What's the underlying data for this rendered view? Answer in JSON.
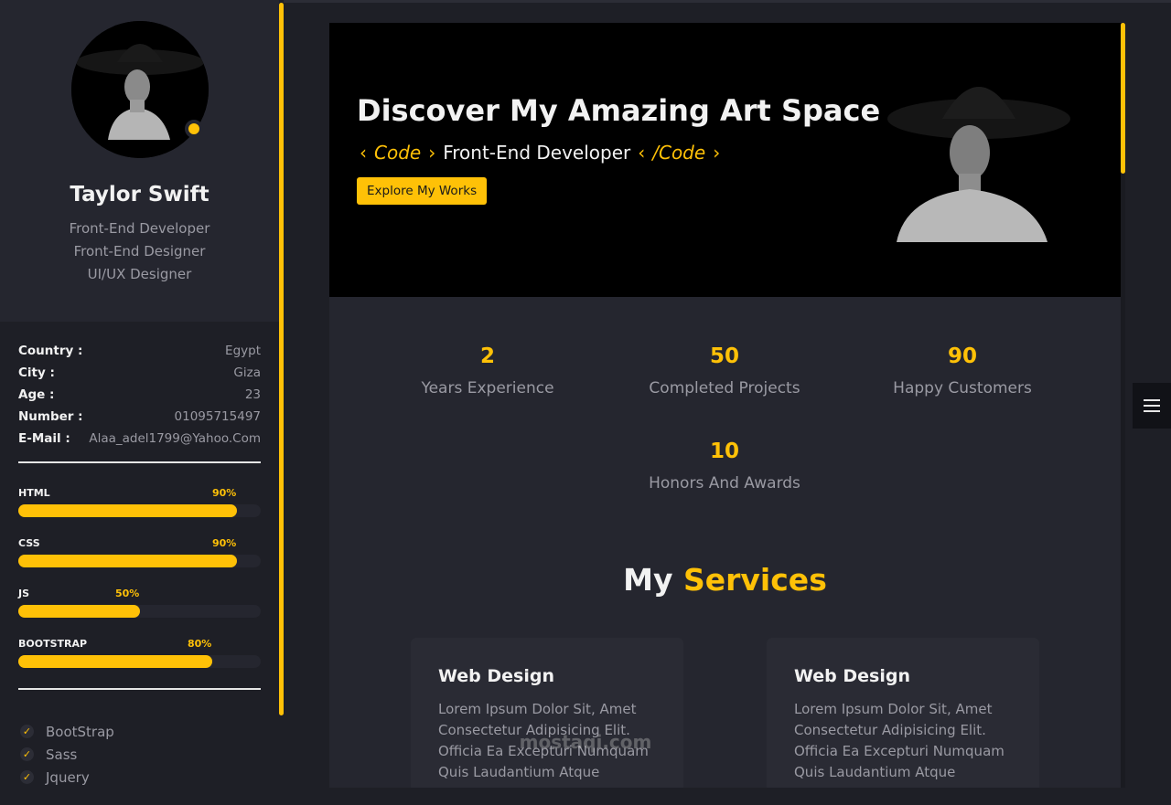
{
  "profile": {
    "name": "Taylor Swift",
    "roles": [
      "Front-End Developer",
      "Front-End Designer",
      "UI/UX Designer"
    ]
  },
  "info": [
    {
      "key": "Country :",
      "value": "Egypt"
    },
    {
      "key": "City :",
      "value": "Giza"
    },
    {
      "key": "Age :",
      "value": "23"
    },
    {
      "key": "Number :",
      "value": "01095715497"
    },
    {
      "key": "E-Mail :",
      "value": "Alaa_adel1799@Yahoo.Com"
    }
  ],
  "skills": [
    {
      "name": "HTML",
      "percent_label": "90%",
      "percent": 90
    },
    {
      "name": "CSS",
      "percent_label": "90%",
      "percent": 90
    },
    {
      "name": "JS",
      "percent_label": "50%",
      "percent": 50
    },
    {
      "name": "BOOTSTRAP",
      "percent_label": "80%",
      "percent": 80
    }
  ],
  "extras": [
    "BootStrap",
    "Sass",
    "Jquery"
  ],
  "hero": {
    "title": "Discover My Amazing Art Space",
    "code_open": "Code",
    "role": "Front-End Developer",
    "code_close": "/Code",
    "button": "Explore My Works"
  },
  "stats": [
    {
      "num": "2",
      "label": "Years Experience"
    },
    {
      "num": "50",
      "label": "Completed Projects"
    },
    {
      "num": "90",
      "label": "Happy Customers"
    },
    {
      "num": "10",
      "label": "Honors And Awards"
    }
  ],
  "services": {
    "title_plain": "My",
    "title_highlight": "Services",
    "cards": [
      {
        "title": "Web Design",
        "text": "Lorem Ipsum Dolor Sit, Amet Consectetur Adipisicing Elit. Officia Ea Excepturi Numquam Quis Laudantium Atque"
      },
      {
        "title": "Web Design",
        "text": "Lorem Ipsum Dolor Sit, Amet Consectetur Adipisicing Elit. Officia Ea Excepturi Numquam Quis Laudantium Atque"
      }
    ]
  },
  "watermark": "mostaqi.com",
  "colors": {
    "accent": "#ffc107",
    "bg": "#1e1f26",
    "panel": "#25262f"
  }
}
